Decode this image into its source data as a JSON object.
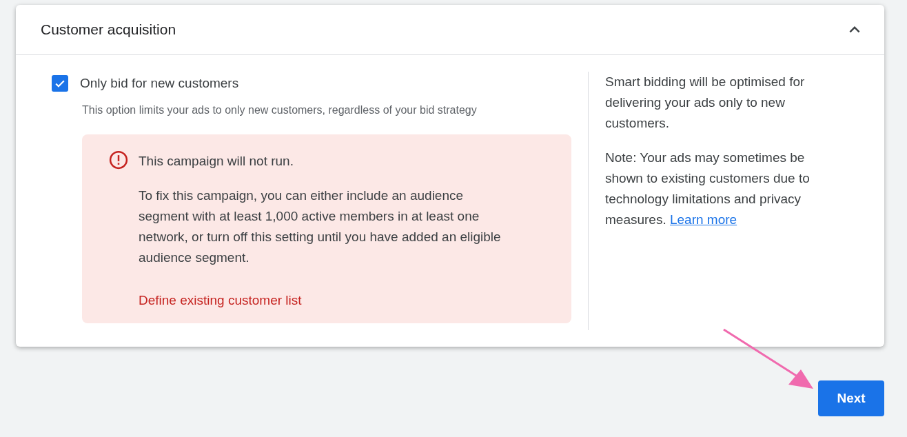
{
  "panel": {
    "title": "Customer acquisition",
    "expanded": true
  },
  "option": {
    "label": "Only bid for new customers",
    "checked": true,
    "description": "This option limits your ads to only new customers, regardless of your bid strategy"
  },
  "alert": {
    "title": "This campaign will not run.",
    "message": "To fix this campaign, you can either include an audience segment with at least 1,000 active members in at least one network, or turn off this setting until you have added an eligible audience segment.",
    "action": "Define existing customer list"
  },
  "help": {
    "summary": "Smart bidding will be optimised for delivering your ads only to new customers.",
    "note": "Note: Your ads may sometimes be shown to existing customers due to technology limitations and privacy measures.",
    "link": "Learn more"
  },
  "buttons": [
    {
      "label": "Next"
    }
  ]
}
